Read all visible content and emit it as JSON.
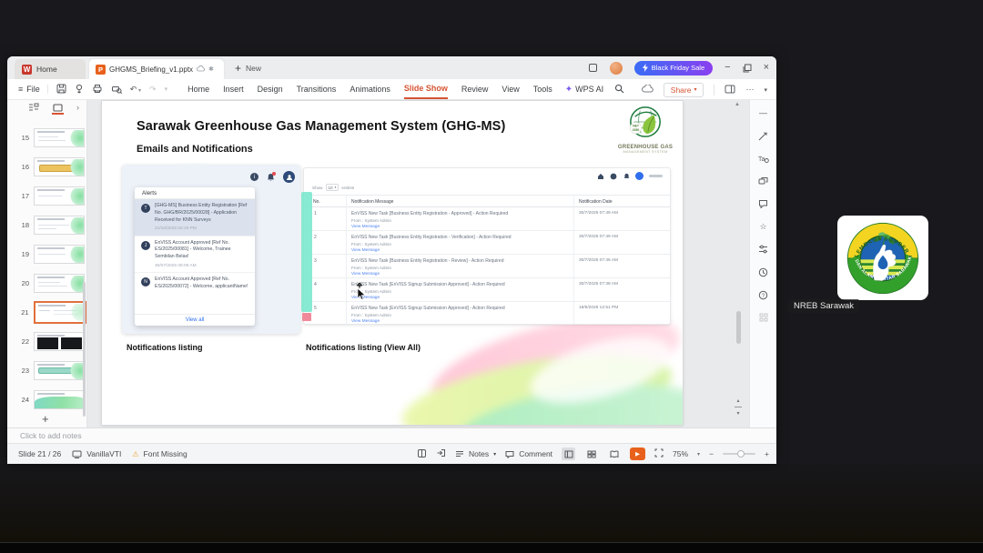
{
  "colors": {
    "accent_orange": "#d75434",
    "wps_play_orange": "#e8611c",
    "promo_gradient_from": "#3a6cf6",
    "promo_gradient_to": "#8a3ff0",
    "link_blue": "#4f83f1",
    "teal_highlight": "#7ce8cf",
    "dark_background": "#19191d",
    "alert_highlight": "#dbe2ee"
  },
  "titlebar": {
    "home_tab": "Home",
    "doc_tab": "GHGMS_Briefing_v1.pptx",
    "new_tab": "New",
    "promo": "Black Friday Sale"
  },
  "toolbar": {
    "file": "File",
    "menu": [
      "Home",
      "Insert",
      "Design",
      "Transitions",
      "Animations",
      "Slide Show",
      "Review",
      "View",
      "Tools"
    ],
    "active_menu": "Slide Show",
    "wps_ai": "WPS AI",
    "share": "Share"
  },
  "thumbnails": {
    "numbers": [
      "15",
      "16",
      "17",
      "18",
      "19",
      "20",
      "21",
      "22",
      "23",
      "24"
    ],
    "selected": "21"
  },
  "slide": {
    "title": "Sarawak Greenhouse Gas Management System (GHG-MS)",
    "subtitle": "Emails and Notifications",
    "logo": {
      "name": "GREENHOUSE GAS",
      "tag": "MANAGEMENT SYSTEM",
      "net": "NET",
      "year": "2050"
    },
    "caption_left": "Notifications listing",
    "caption_right": "Notifications listing (View All)",
    "alerts": {
      "header": "Alerts",
      "view_all": "View all",
      "items": [
        {
          "avatar": "T",
          "text": "[GHG-MS] Business Entity Registration [Ref No. GHG/BR/2025/00028] - Application Received for KNN Surveys",
          "time": "21/10/2025 02:19 PM"
        },
        {
          "avatar": "J",
          "text": "EnVISS Account Approved [Ref No. ES/2025/00081] - Welcome, Trainee Sembilan Belas!",
          "time": "30/07/2025 09:09 AM"
        },
        {
          "avatar": "N",
          "text": "EnVISS Account Approved [Ref No. ES/2025/00072] - Welcome, applicantName!",
          "time": ""
        }
      ]
    },
    "listing": {
      "show": "Show",
      "page_size": "10",
      "entries": "entries",
      "col_no": "No.",
      "col_msg": "Notification Message",
      "col_date": "Notification Date",
      "from": "From : System Admin",
      "link": "View Message",
      "rows": [
        {
          "no": "1",
          "msg": "EnVISS New Task [Business Entity Registration - Approved] - Action Required",
          "date": "30/7/2025 07:49 AM"
        },
        {
          "no": "2",
          "msg": "EnVISS New Task [Business Entity Registration - Verification] - Action Required",
          "date": "30/7/2025 07:49 AM"
        },
        {
          "no": "3",
          "msg": "EnVISS New Task [Business Entity Registration - Review] - Action Required",
          "date": "30/7/2025 07:46 AM"
        },
        {
          "no": "4",
          "msg": "EnVISS New Task [EnVISS Signup Submission Approved] - Action Required",
          "date": "30/7/2025 07:38 AM"
        },
        {
          "no": "5",
          "msg": "EnVISS New Task [EnVISS Signup Submission Approved] - Action Required",
          "date": "18/6/2025 12:51 PM"
        }
      ]
    }
  },
  "notes": {
    "placeholder": "Click to add notes"
  },
  "statusbar": {
    "slide_info": "Slide 21 / 26",
    "theme": "VanillaVTI",
    "font_missing": "Font Missing",
    "notes": "Notes",
    "comment": "Comment",
    "zoom": "75%"
  },
  "meeting": {
    "participant_label": "NREB Sarawak",
    "emblem_top_text": "LEMBAGA SUMBER ASLI",
    "emblem_bottom_text": "DAN ALAM SEKITAR SARAWAK"
  }
}
